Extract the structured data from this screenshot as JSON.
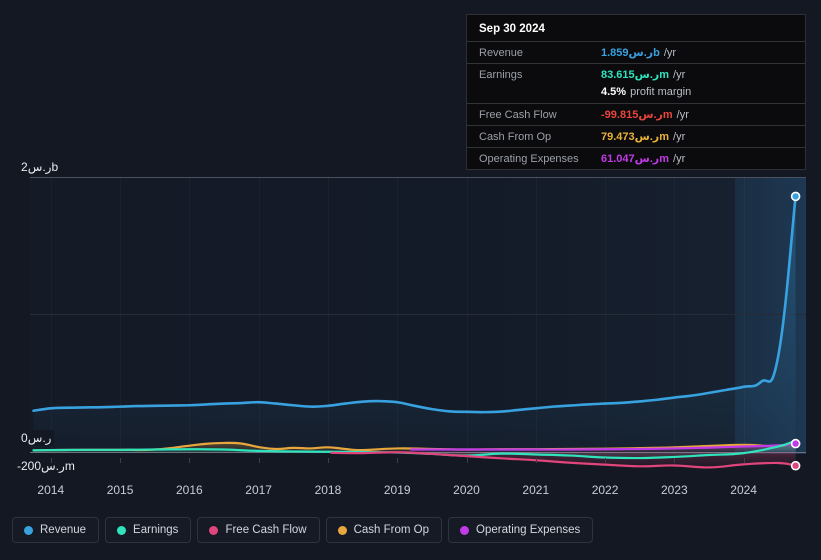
{
  "chart_data": {
    "type": "area",
    "title": "",
    "xlabel": "",
    "ylabel": "",
    "currency_symbol": "ر.س",
    "grid": true,
    "legend_position": "bottom",
    "ylim": [
      -200000000,
      2000000000
    ],
    "y_ticks": [
      {
        "label": "2ر.سb",
        "value": 2000000000
      },
      {
        "label": "0ر.س",
        "value": 0
      },
      {
        "label": "-200ر.سm",
        "value": -200000000
      }
    ],
    "x_ticks": [
      "2014",
      "2015",
      "2016",
      "2017",
      "2018",
      "2019",
      "2020",
      "2021",
      "2022",
      "2023",
      "2024"
    ],
    "x_range": [
      2013.7,
      2024.9
    ],
    "series": [
      {
        "name": "Revenue",
        "color": "#38a2e0",
        "x": [
          2013.75,
          2014.0,
          2014.25,
          2014.5,
          2014.75,
          2015.0,
          2015.25,
          2015.5,
          2015.75,
          2016.0,
          2016.25,
          2016.5,
          2016.75,
          2017.0,
          2017.25,
          2017.5,
          2017.75,
          2018.0,
          2018.25,
          2018.5,
          2018.75,
          2019.0,
          2019.25,
          2019.5,
          2019.75,
          2020.0,
          2020.25,
          2020.5,
          2020.75,
          2021.0,
          2021.25,
          2021.5,
          2021.75,
          2022.0,
          2022.25,
          2022.5,
          2022.75,
          2023.0,
          2023.25,
          2023.5,
          2023.75,
          2024.0,
          2024.25,
          2024.5,
          2024.75
        ],
        "values": [
          0.3,
          0.318,
          0.322,
          0.324,
          0.326,
          0.33,
          0.334,
          0.336,
          0.338,
          0.34,
          0.346,
          0.352,
          0.356,
          0.362,
          0.352,
          0.34,
          0.33,
          0.336,
          0.352,
          0.366,
          0.37,
          0.362,
          0.336,
          0.312,
          0.296,
          0.292,
          0.29,
          0.294,
          0.306,
          0.318,
          0.33,
          0.338,
          0.346,
          0.352,
          0.358,
          0.368,
          0.38,
          0.396,
          0.41,
          0.43,
          0.452,
          0.474,
          0.51,
          0.7,
          1.859
        ],
        "unit": "b"
      },
      {
        "name": "Earnings",
        "color": "#2fe3bd",
        "x": [
          2013.75,
          2014.0,
          2014.5,
          2015.0,
          2015.5,
          2016.0,
          2016.5,
          2017.0,
          2017.5,
          2018.0,
          2018.5,
          2019.0,
          2019.5,
          2020.0,
          2020.5,
          2021.0,
          2021.5,
          2022.0,
          2022.5,
          2023.0,
          2023.5,
          2024.0,
          2024.5,
          2024.75
        ],
        "values": [
          0.012,
          0.014,
          0.016,
          0.016,
          0.018,
          0.02,
          0.018,
          0.008,
          0.004,
          0.002,
          0.0,
          -0.004,
          -0.014,
          -0.026,
          -0.012,
          -0.018,
          -0.026,
          -0.04,
          -0.044,
          -0.036,
          -0.022,
          -0.008,
          0.04,
          0.0836
        ],
        "unit": "b"
      },
      {
        "name": "Free Cash Flow",
        "color": "#e0457b",
        "x": [
          2018.05,
          2018.5,
          2019.0,
          2019.5,
          2020.0,
          2020.5,
          2021.0,
          2021.5,
          2022.0,
          2022.5,
          2023.0,
          2023.5,
          2024.0,
          2024.5,
          2024.75
        ],
        "values": [
          -0.006,
          -0.008,
          -0.002,
          -0.014,
          -0.03,
          -0.046,
          -0.06,
          -0.078,
          -0.092,
          -0.104,
          -0.098,
          -0.112,
          -0.09,
          -0.08,
          -0.0998
        ],
        "unit": "b"
      },
      {
        "name": "Cash From Op",
        "color": "#e8a73d",
        "x": [
          2013.75,
          2014.0,
          2014.5,
          2015.0,
          2015.5,
          2016.0,
          2016.25,
          2016.5,
          2016.75,
          2017.0,
          2017.25,
          2017.5,
          2017.75,
          2018.0,
          2018.25,
          2018.5,
          2019.0,
          2019.5,
          2020.0,
          2020.5,
          2021.0,
          2021.5,
          2022.0,
          2022.5,
          2023.0,
          2023.5,
          2024.0,
          2024.5,
          2024.75
        ],
        "values": [
          0.012,
          0.014,
          0.016,
          0.016,
          0.018,
          0.046,
          0.06,
          0.066,
          0.062,
          0.036,
          0.022,
          0.03,
          0.026,
          0.034,
          0.022,
          0.014,
          0.026,
          0.022,
          0.018,
          0.02,
          0.02,
          0.022,
          0.024,
          0.028,
          0.034,
          0.044,
          0.052,
          0.044,
          0.0795
        ],
        "unit": "b"
      },
      {
        "name": "Operating Expenses",
        "color": "#c23ae8",
        "x": [
          2019.2,
          2019.5,
          2020.0,
          2020.5,
          2021.0,
          2021.5,
          2022.0,
          2022.5,
          2023.0,
          2023.5,
          2024.0,
          2024.5,
          2024.75
        ],
        "values": [
          0.018,
          0.018,
          0.018,
          0.018,
          0.018,
          0.018,
          0.02,
          0.022,
          0.026,
          0.032,
          0.04,
          0.048,
          0.061
        ],
        "unit": "b"
      }
    ],
    "highlight_band": {
      "from": 2023.95,
      "to": 2024.9
    }
  },
  "tooltip": {
    "date": "Sep 30 2024",
    "rows": [
      {
        "label": "Revenue",
        "value": "1.859ر.سb",
        "unit": "/yr",
        "color": "#38a2e0"
      },
      {
        "label": "Earnings",
        "value": "83.615ر.سm",
        "unit": "/yr",
        "color": "#2fe3bd"
      },
      {
        "label": "",
        "value": "4.5%",
        "unit": "profit margin",
        "color": "#ffffff"
      },
      {
        "label": "Free Cash Flow",
        "value": "-99.815ر.سm",
        "unit": "/yr",
        "color": "#e8453c"
      },
      {
        "label": "Cash From Op",
        "value": "79.473ر.سm",
        "unit": "/yr",
        "color": "#e8b339"
      },
      {
        "label": "Operating Expenses",
        "value": "61.047ر.سm",
        "unit": "/yr",
        "color": "#c23ae8"
      }
    ]
  },
  "legend": {
    "items": [
      {
        "label": "Revenue",
        "color": "#38a2e0"
      },
      {
        "label": "Earnings",
        "color": "#2fe3bd"
      },
      {
        "label": "Free Cash Flow",
        "color": "#e0457b"
      },
      {
        "label": "Cash From Op",
        "color": "#e8a73d"
      },
      {
        "label": "Operating Expenses",
        "color": "#c23ae8"
      }
    ]
  },
  "axis": {
    "y_top_label": "2ر.سb",
    "y_zero_label": "0ر.س",
    "y_neg_label": "-200ر.سm"
  }
}
